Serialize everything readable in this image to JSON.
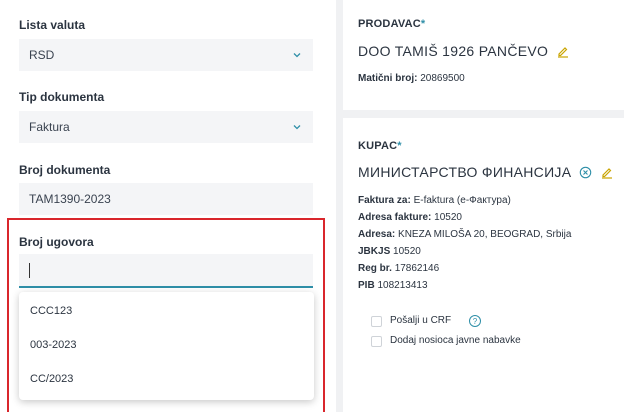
{
  "left": {
    "currency": {
      "label": "Lista valuta",
      "value": "RSD"
    },
    "doc_type": {
      "label": "Tip dokumenta",
      "value": "Faktura"
    },
    "doc_number": {
      "label": "Broj dokumenta",
      "value": "TAM1390-2023"
    },
    "contract": {
      "label": "Broj ugovora",
      "value": "",
      "options": [
        "CCC123",
        "003-2023",
        "CC/2023"
      ]
    }
  },
  "seller": {
    "title": "PRODAVAC",
    "required_mark": "*",
    "name": "DOO TAMIŠ 1926 PANČEVO",
    "mb_label": "Matični broj:",
    "mb_value": "20869500"
  },
  "buyer": {
    "title": "KUPAC",
    "required_mark": "*",
    "name": "МИНИСТАРСТВО ФИНАНСИЈА",
    "lines": [
      {
        "label": "Faktura za:",
        "value": "E-faktura (е-Фактура)"
      },
      {
        "label": "Adresa fakture:",
        "value": "10520"
      },
      {
        "label": "Adresa:",
        "value": "KNEZA MILOŠA 20, BEOGRAD, Srbija"
      },
      {
        "label": "JBKJS",
        "value": "10520"
      },
      {
        "label": "Reg br.",
        "value": "17862146"
      },
      {
        "label": "PIB",
        "value": "108213413"
      }
    ],
    "checkboxes": [
      {
        "label": "Pošalji u CRF",
        "checked": false
      },
      {
        "label": "Dodaj nosioca javne nabavke",
        "checked": false
      }
    ],
    "help_glyph": "?"
  },
  "colors": {
    "accent": "#2f8fa8",
    "highlight": "#d9262c",
    "pencil": "#c9a400"
  }
}
